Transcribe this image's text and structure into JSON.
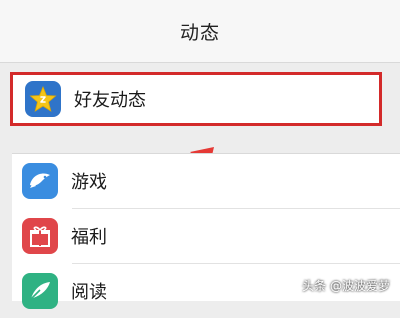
{
  "header": {
    "title": "动态"
  },
  "highlighted_item": {
    "label": "好友动态",
    "icon": "star-icon"
  },
  "items": [
    {
      "label": "游戏",
      "icon": "game-icon"
    },
    {
      "label": "福利",
      "icon": "gift-icon"
    },
    {
      "label": "阅读",
      "icon": "book-icon"
    }
  ],
  "watermark": "头条 @波波爱萝",
  "colors": {
    "highlight_border": "#d32a2a",
    "arrow": "#e53935",
    "star_icon_bg": "#2f74c9",
    "game_icon_bg": "#3a8de0",
    "gift_icon_bg": "#e0464a",
    "book_icon_bg": "#2fb283"
  }
}
